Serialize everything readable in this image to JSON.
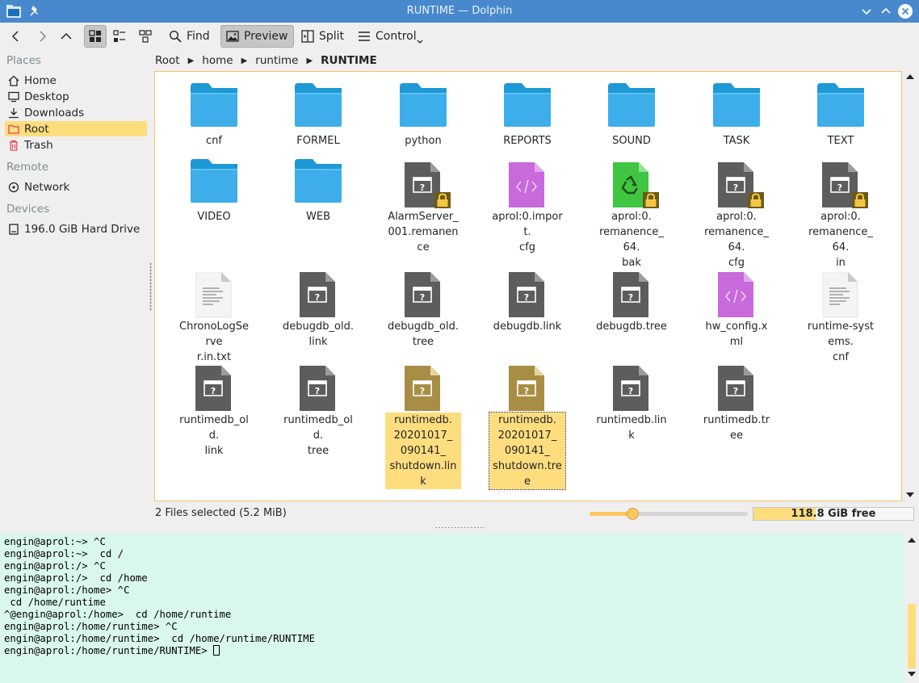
{
  "window": {
    "title": "RUNTIME — Dolphin"
  },
  "toolbar": {
    "find_label": "Find",
    "preview_label": "Preview",
    "split_label": "Split",
    "control_label": "Control"
  },
  "places": {
    "places_title": "Places",
    "items": [
      {
        "label": "Home",
        "icon": "home-icon"
      },
      {
        "label": "Desktop",
        "icon": "desktop-icon"
      },
      {
        "label": "Downloads",
        "icon": "downloads-icon"
      },
      {
        "label": "Root",
        "icon": "folder-red-icon",
        "selected": true
      },
      {
        "label": "Trash",
        "icon": "trash-icon"
      }
    ],
    "remote_title": "Remote",
    "remote_items": [
      {
        "label": "Network",
        "icon": "network-icon"
      }
    ],
    "devices_title": "Devices",
    "device_items": [
      {
        "label": "196.0 GiB Hard Drive",
        "icon": "harddrive-icon"
      }
    ]
  },
  "breadcrumb": {
    "parts": [
      "Root",
      "home",
      "runtime",
      "RUNTIME"
    ]
  },
  "files": [
    {
      "name": "cnf",
      "type": "folder"
    },
    {
      "name": "FORMEL",
      "type": "folder"
    },
    {
      "name": "python",
      "type": "folder"
    },
    {
      "name": "REPORTS",
      "type": "folder"
    },
    {
      "name": "SOUND",
      "type": "folder"
    },
    {
      "name": "TASK",
      "type": "folder"
    },
    {
      "name": "TEXT",
      "type": "folder"
    },
    {
      "name": "VIDEO",
      "type": "folder"
    },
    {
      "name": "WEB",
      "type": "folder"
    },
    {
      "name": "AlarmServer_\n001.remanence",
      "type": "unknown-locked"
    },
    {
      "name": "aprol:0.import.\ncfg",
      "type": "xml"
    },
    {
      "name": "aprol:0.\nremanence_64.\nbak",
      "type": "recycle-locked"
    },
    {
      "name": "aprol:0.\nremanence_64.\ncfg",
      "type": "unknown-locked"
    },
    {
      "name": "aprol:0.\nremanence_64.\nin",
      "type": "unknown-locked"
    },
    {
      "name": "ChronoLogServe\nr.in.txt",
      "type": "text"
    },
    {
      "name": "debugdb_old.\nlink",
      "type": "unknown"
    },
    {
      "name": "debugdb_old.\ntree",
      "type": "unknown"
    },
    {
      "name": "debugdb.link",
      "type": "unknown"
    },
    {
      "name": "debugdb.tree",
      "type": "unknown"
    },
    {
      "name": "hw_config.xml",
      "type": "xml"
    },
    {
      "name": "runtime-systems.\ncnf",
      "type": "text"
    },
    {
      "name": "runtimedb_old.\nlink",
      "type": "unknown"
    },
    {
      "name": "runtimedb_old.\ntree",
      "type": "unknown"
    },
    {
      "name": "runtimedb.\n20201017_\n090141_\nshutdown.link",
      "type": "unknown-selected",
      "selected": true
    },
    {
      "name": "runtimedb.\n20201017_\n090141_\nshutdown.tree",
      "type": "unknown-selected",
      "selected": true,
      "focus": true
    },
    {
      "name": "runtimedb.link",
      "type": "unknown"
    },
    {
      "name": "runtimedb.tree",
      "type": "unknown"
    }
  ],
  "statusbar": {
    "selection": "2 Files selected (5.2 MiB)",
    "free_space": "118.8 GiB free",
    "used_fraction": 0.39,
    "zoom_fraction": 0.27
  },
  "terminal": {
    "lines": [
      "engin@aprol:~> ^C",
      "engin@aprol:~>  cd /",
      "engin@aprol:/> ^C",
      "engin@aprol:/>  cd /home",
      "engin@aprol:/home> ^C",
      " cd /home/runtime",
      "^@engin@aprol:/home>  cd /home/runtime",
      "engin@aprol:/home/runtime> ^C",
      "engin@aprol:/home/runtime>  cd /home/runtime/RUNTIME"
    ],
    "prompt": "engin@aprol:/home/runtime/RUNTIME> "
  },
  "colors": {
    "titlebar": "#4889cd",
    "selection": "#fedd7e",
    "folder": "#3daee9",
    "terminal_bg": "#d9f7ea"
  }
}
